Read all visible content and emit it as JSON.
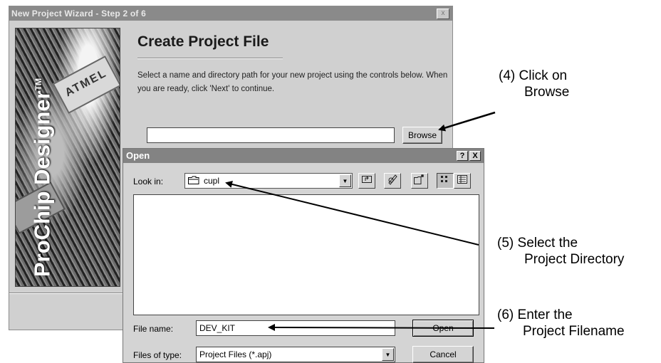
{
  "wizard": {
    "title": "New Project Wizard - Step 2 of 6",
    "close_symbol": "x",
    "brand": "ProChip Designer",
    "brand_tm": "TM",
    "chip_text": "ATMEL",
    "heading": "Create Project File",
    "description": "Select a name and directory path for your new project using the controls below. When you are ready, click 'Next' to continue.",
    "project_path_value": "",
    "browse_label": "Browse"
  },
  "open_dialog": {
    "title": "Open",
    "help_symbol": "?",
    "close_symbol": "X",
    "look_in_label": "Look in:",
    "look_in_value": "cupl",
    "file_name_label": "File name:",
    "file_name_value": "DEV_KIT",
    "files_of_type_label": "Files of type:",
    "files_of_type_value": "Project Files (*.apj)",
    "open_label": "Open",
    "cancel_label": "Cancel",
    "toolbar_icons": [
      "up-one-level-icon",
      "desktop-icon",
      "new-folder-icon",
      "list-view-icon",
      "details-view-icon"
    ]
  },
  "annotations": {
    "step4_num": "(4)",
    "step4_line1": "Click on",
    "step4_line2": "Browse",
    "step5_num": "(5)",
    "step5_line1": "Select the",
    "step5_line2": "Project Directory",
    "step6_num": "(6)",
    "step6_line1": "Enter the",
    "step6_line2": "Project Filename"
  }
}
